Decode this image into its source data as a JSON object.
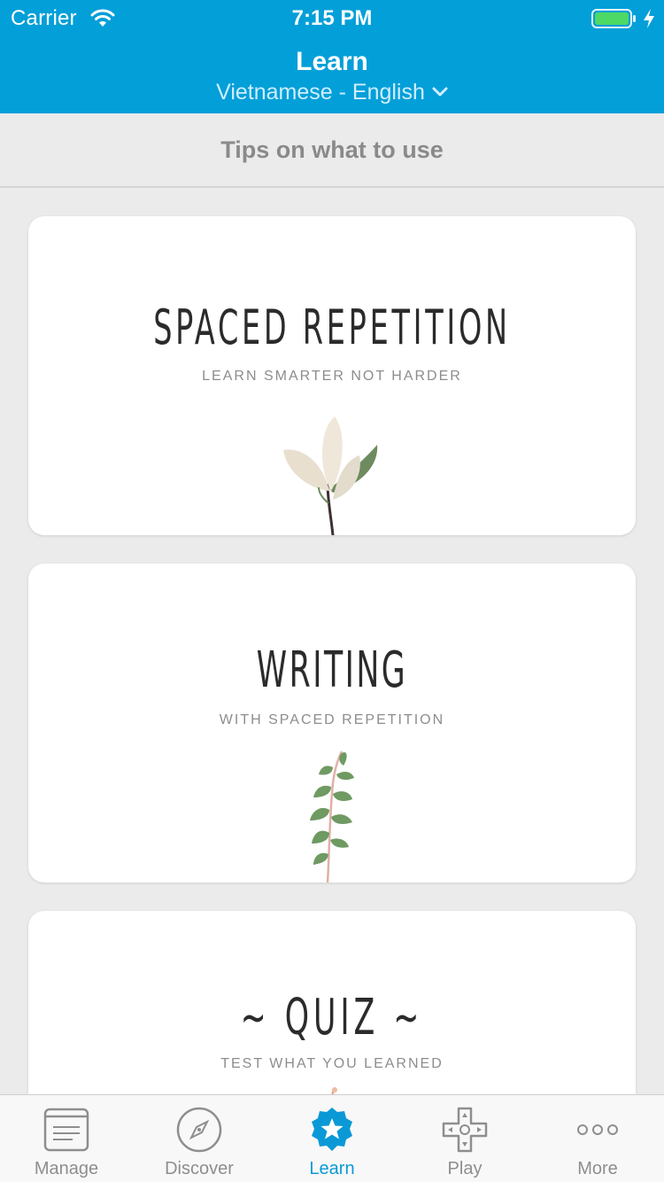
{
  "status_bar": {
    "carrier": "Carrier",
    "time": "7:15 PM",
    "battery_level": 1.0
  },
  "nav": {
    "title": "Learn",
    "subtitle": "Vietnamese - English"
  },
  "tips": {
    "label": "Tips on what to use"
  },
  "cards": [
    {
      "title": "SPACED REPETITION",
      "subtitle": "LEARN SMARTER NOT HARDER",
      "icon": "magnolia-plant-icon"
    },
    {
      "title": "WRITING",
      "subtitle": "WITH SPACED REPETITION",
      "icon": "eucalyptus-plant-icon"
    },
    {
      "title": "~ QUIZ ~",
      "subtitle": "TEST WHAT YOU LEARNED",
      "icon": "flower-plant-icon"
    }
  ],
  "tabbar": {
    "items": [
      {
        "label": "Manage",
        "icon": "manage-icon",
        "active": false
      },
      {
        "label": "Discover",
        "icon": "compass-icon",
        "active": false
      },
      {
        "label": "Learn",
        "icon": "badge-star-icon",
        "active": true
      },
      {
        "label": "Play",
        "icon": "gamepad-icon",
        "active": false
      },
      {
        "label": "More",
        "icon": "more-icon",
        "active": false
      }
    ]
  },
  "colors": {
    "brand": "#039fd8",
    "active_tab": "#0a99d6",
    "inactive_tab": "#8e8e8e",
    "background": "#ebebeb"
  }
}
